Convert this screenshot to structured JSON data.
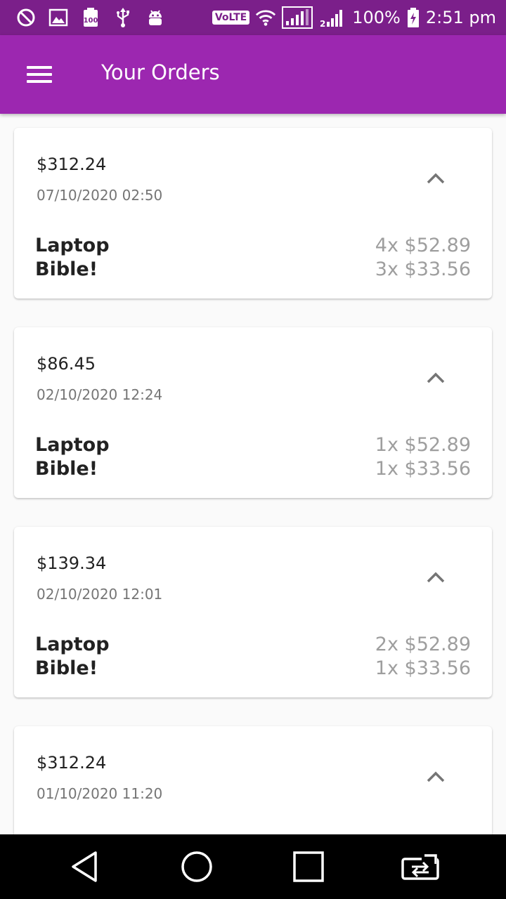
{
  "status_bar": {
    "left_icons": [
      "do-not-disturb-icon",
      "gallery-icon",
      "storage-100-icon",
      "usb-icon",
      "android-debug-icon"
    ],
    "volte": "VoLTE",
    "battery_percent": "100%",
    "time": "2:51 pm"
  },
  "app_bar": {
    "title": "Your Orders",
    "menu_icon": "hamburger-menu-icon"
  },
  "colors": {
    "primary": "#9c27b0",
    "status_bar": "#7b1f8a",
    "text_primary": "#222222",
    "text_secondary": "#757575",
    "price_gray": "#9e9e9e"
  },
  "orders": [
    {
      "total": "$312.24",
      "date": "07/10/2020 02:50",
      "items": [
        {
          "name": "Laptop",
          "price": "4x $52.89"
        },
        {
          "name": "Bible!",
          "price": "3x $33.56"
        }
      ]
    },
    {
      "total": "$86.45",
      "date": "02/10/2020 12:24",
      "items": [
        {
          "name": "Laptop",
          "price": "1x $52.89"
        },
        {
          "name": "Bible!",
          "price": "1x $33.56"
        }
      ]
    },
    {
      "total": "$139.34",
      "date": "02/10/2020 12:01",
      "items": [
        {
          "name": "Laptop",
          "price": "2x $52.89"
        },
        {
          "name": "Bible!",
          "price": "1x $33.56"
        }
      ]
    },
    {
      "total": "$312.24",
      "date": "01/10/2020 11:20",
      "items": []
    }
  ],
  "nav_bar": {
    "buttons": [
      "back-icon",
      "home-icon",
      "recents-icon",
      "screen-switch-icon"
    ]
  }
}
